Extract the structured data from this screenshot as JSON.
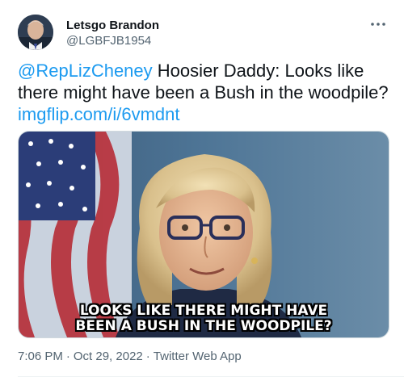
{
  "user": {
    "display_name": "Letsgo Brandon",
    "handle": "@LGBFJB1954",
    "avatar_icon": "avatar"
  },
  "more_icon": "more-horizontal-icon",
  "tweet": {
    "mention": "@RepLizCheney",
    "body": " Hoosier Daddy: Looks like there might have been a Bush in the woodpile?",
    "link": "imgflip.com/i/6vmdnt"
  },
  "media": {
    "caption_line1": "Looks like there might have",
    "caption_line2": "been a Bush in the woodpile?"
  },
  "meta": {
    "time": "7:06 PM",
    "date": "Oct 29, 2022",
    "source": "Twitter Web App"
  },
  "colors": {
    "link": "#1d9bf0",
    "secondary_text": "#536471"
  }
}
